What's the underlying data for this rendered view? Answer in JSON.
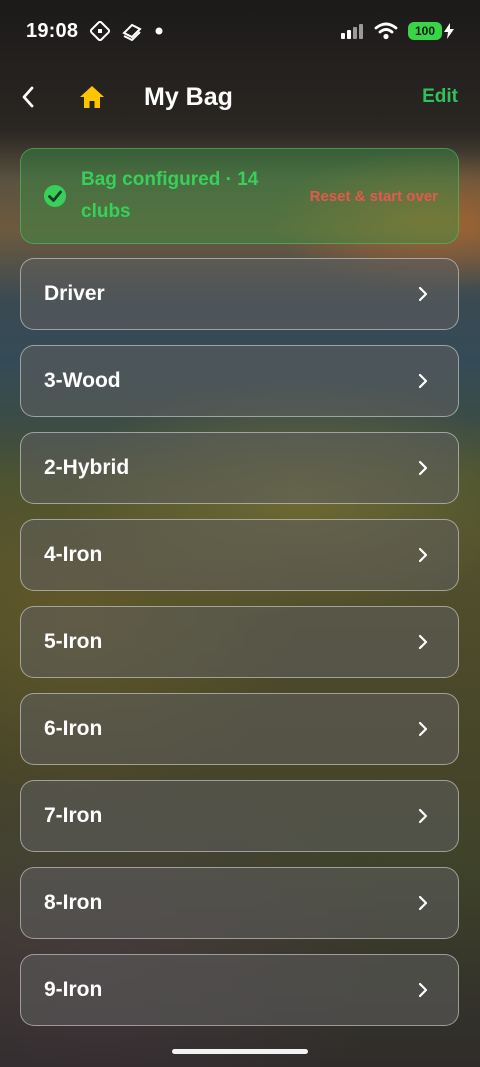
{
  "status_bar": {
    "time": "19:08",
    "battery": "100",
    "icons": [
      "notification-grid-icon",
      "app-stack-icon",
      "dot-icon",
      "signal-icon",
      "wifi-icon",
      "battery-icon",
      "charging-bolt-icon"
    ]
  },
  "header": {
    "title": "My Bag",
    "edit_label": "Edit",
    "icons": [
      "back-chevron-icon",
      "home-icon"
    ],
    "home_icon_color": "#ffc400",
    "edit_color": "#30c15a"
  },
  "banner": {
    "message": "Bag configured · 14 clubs",
    "reset_label": "Reset & start over",
    "icon": "check-circle-icon",
    "accent_color": "#37d05a",
    "reset_color": "#e25a4e"
  },
  "clubs": [
    {
      "name": "Driver"
    },
    {
      "name": "3-Wood"
    },
    {
      "name": "2-Hybrid"
    },
    {
      "name": "4-Iron"
    },
    {
      "name": "5-Iron"
    },
    {
      "name": "6-Iron"
    },
    {
      "name": "7-Iron"
    },
    {
      "name": "8-Iron"
    },
    {
      "name": "9-Iron"
    }
  ]
}
